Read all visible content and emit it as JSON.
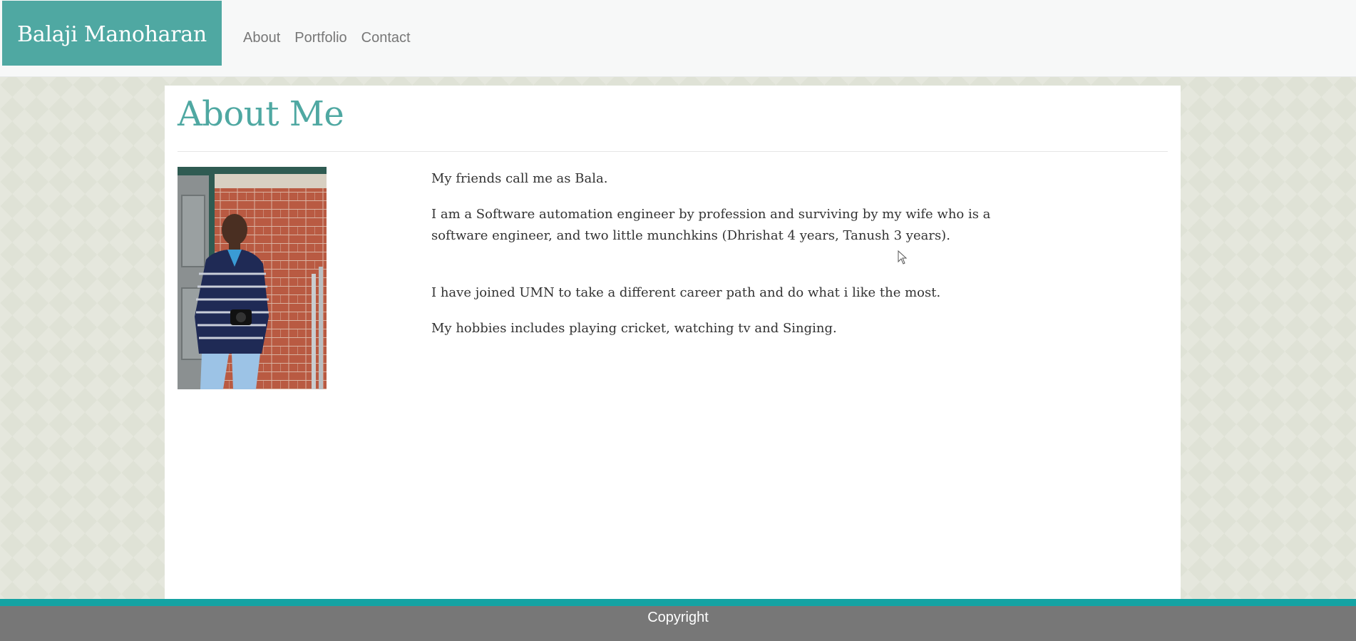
{
  "header": {
    "brand": "Balaji Manoharan",
    "nav": [
      "About",
      "Portfolio",
      "Contact"
    ]
  },
  "main": {
    "title": "About Me",
    "photo_alt": "Balaji Manoharan profile photo",
    "paragraphs": [
      "My friends call me as Bala.",
      "I am a Software automation engineer by profession and surviving by my wife who is a software engineer, and two little munchkins (Dhrishat 4 years, Tanush 3 years).",
      "I have joined UMN to take a different career path and do what i like the most.",
      "My hobbies includes playing cricket, watching tv and Singing."
    ]
  },
  "footer": {
    "text": "Copyright"
  },
  "colors": {
    "brand_bg": "#4fa8a2",
    "title": "#4fa8a2",
    "footer_stripe": "#14a3a3",
    "footer_bg": "#777777",
    "page_bg": "#dfe2d6"
  }
}
